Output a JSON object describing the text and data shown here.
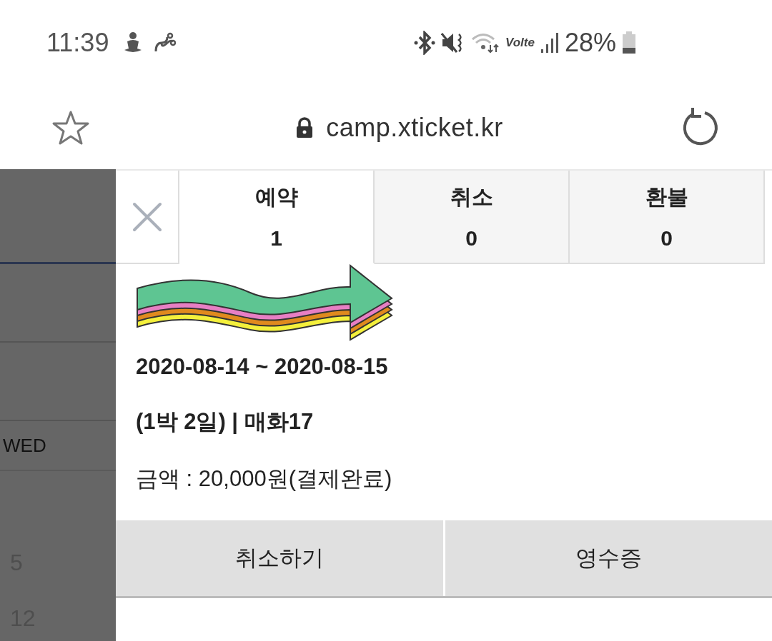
{
  "status_bar": {
    "time": "11:39",
    "network_label": "Volte",
    "battery": "28%"
  },
  "browser": {
    "url": "camp.xticket.kr"
  },
  "calendar": {
    "weekday": "WED",
    "days": [
      "5",
      "12"
    ]
  },
  "tabs": [
    {
      "label": "예약",
      "count": "1",
      "selected": true
    },
    {
      "label": "취소",
      "count": "0",
      "selected": false
    },
    {
      "label": "환불",
      "count": "0",
      "selected": false
    }
  ],
  "reservation": {
    "dates": "2020-08-14 ~ 2020-08-15",
    "details": "(1박 2일) | 매화17",
    "amount": "금액 : 20,000원(결제완료)"
  },
  "buttons": [
    "취소하기",
    "영수증"
  ]
}
